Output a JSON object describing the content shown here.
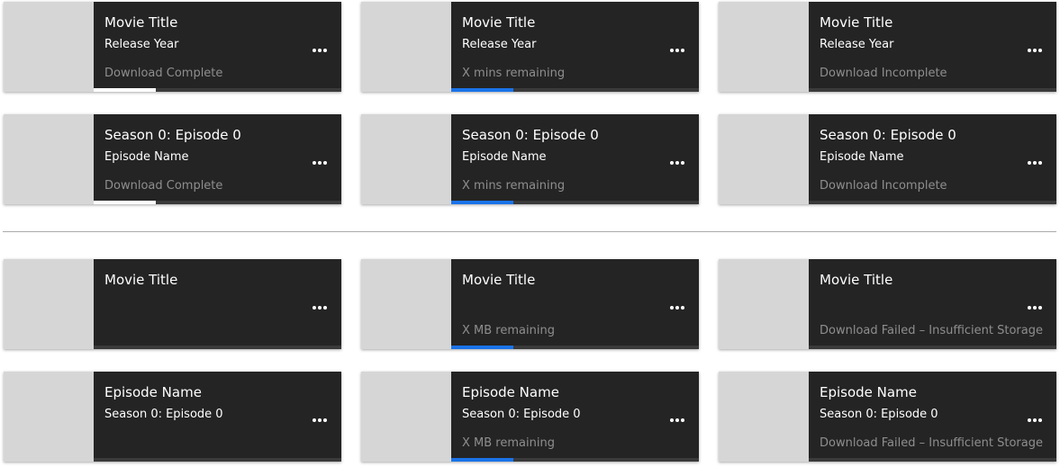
{
  "colors": {
    "card_bg": "#242424",
    "thumbnail": "#d6d6d6",
    "status_text": "#8e8e8e",
    "progress_complete": "#ffffff",
    "progress_active": "#1a73e8",
    "divider": "#aaaaaa"
  },
  "cards": [
    {
      "title": "Movie Title",
      "subtitle": "Release Year",
      "status": "Download Complete",
      "progress": 0.5,
      "progress_color": "#ffffff",
      "menu_icon": "more-horizontal-icon"
    },
    {
      "title": "Movie Title",
      "subtitle": "Release Year",
      "status": "X mins remaining",
      "progress": 0.5,
      "progress_color": "#1a73e8",
      "menu_icon": "more-horizontal-icon"
    },
    {
      "title": "Movie Title",
      "subtitle": "Release Year",
      "status": "Download Incomplete",
      "progress": 0,
      "progress_color": "#1a73e8",
      "menu_icon": "more-horizontal-icon"
    },
    {
      "title": "Season 0: Episode 0",
      "subtitle": "Episode Name",
      "status": "Download Complete",
      "progress": 0.5,
      "progress_color": "#ffffff",
      "menu_icon": "more-horizontal-icon"
    },
    {
      "title": "Season 0: Episode 0",
      "subtitle": "Episode Name",
      "status": "X mins remaining",
      "progress": 0.5,
      "progress_color": "#1a73e8",
      "menu_icon": "more-horizontal-icon"
    },
    {
      "title": "Season 0: Episode 0",
      "subtitle": "Episode Name",
      "status": "Download Incomplete",
      "progress": 0,
      "progress_color": "#1a73e8",
      "menu_icon": "more-horizontal-icon"
    },
    {
      "title": "Movie Title",
      "subtitle": "",
      "status": "",
      "progress": 0,
      "progress_color": "#1a73e8",
      "menu_icon": "more-horizontal-icon"
    },
    {
      "title": "Movie Title",
      "subtitle": "",
      "status": "X MB remaining",
      "progress": 0.5,
      "progress_color": "#1a73e8",
      "menu_icon": "more-horizontal-icon"
    },
    {
      "title": "Movie Title",
      "subtitle": "",
      "status": "Download Failed – Insufficient Storage",
      "progress": 0,
      "progress_color": "#1a73e8",
      "menu_icon": "more-horizontal-icon"
    },
    {
      "title": "Episode Name",
      "subtitle": "Season 0: Episode 0",
      "status": "",
      "progress": 0,
      "progress_color": "#1a73e8",
      "menu_icon": "more-horizontal-icon"
    },
    {
      "title": "Episode Name",
      "subtitle": "Season 0: Episode 0",
      "status": "X MB remaining",
      "progress": 0.5,
      "progress_color": "#1a73e8",
      "menu_icon": "more-horizontal-icon"
    },
    {
      "title": "Episode Name",
      "subtitle": "Season 0: Episode 0",
      "status": "Download Failed – Insufficient Storage",
      "progress": 0,
      "progress_color": "#1a73e8",
      "menu_icon": "more-horizontal-icon"
    }
  ]
}
